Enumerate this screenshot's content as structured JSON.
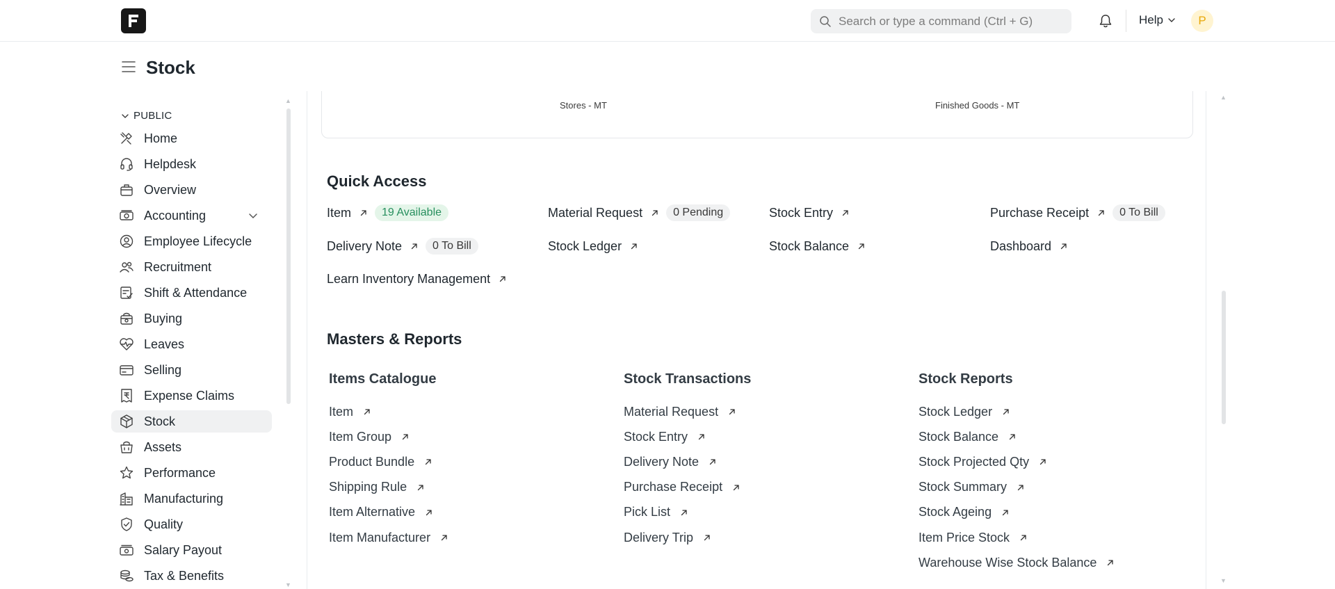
{
  "navbar": {
    "search_placeholder": "Search or type a command (Ctrl + G)",
    "help_label": "Help",
    "avatar_initial": "P"
  },
  "page": {
    "title": "Stock"
  },
  "sidebar": {
    "heading": "PUBLIC",
    "items": [
      {
        "label": "Home",
        "icon": "tools-icon"
      },
      {
        "label": "Helpdesk",
        "icon": "headset-icon"
      },
      {
        "label": "Overview",
        "icon": "briefcase-icon"
      },
      {
        "label": "Accounting",
        "icon": "money-icon"
      },
      {
        "label": "Employee Lifecycle",
        "icon": "user-circle-icon"
      },
      {
        "label": "Recruitment",
        "icon": "users-icon"
      },
      {
        "label": "Shift & Attendance",
        "icon": "checklist-icon"
      },
      {
        "label": "Buying",
        "icon": "bag-icon"
      },
      {
        "label": "Leaves",
        "icon": "heart-pulse-icon"
      },
      {
        "label": "Selling",
        "icon": "card-icon"
      },
      {
        "label": "Expense Claims",
        "icon": "rupee-receipt-icon"
      },
      {
        "label": "Stock",
        "icon": "box-icon",
        "active": true
      },
      {
        "label": "Assets",
        "icon": "basket-icon"
      },
      {
        "label": "Performance",
        "icon": "star-icon"
      },
      {
        "label": "Manufacturing",
        "icon": "building-icon"
      },
      {
        "label": "Quality",
        "icon": "shield-check-icon"
      },
      {
        "label": "Salary Payout",
        "icon": "cash-icon"
      },
      {
        "label": "Tax & Benefits",
        "icon": "coins-icon"
      }
    ]
  },
  "chart": {
    "label_left": "Stores - MT",
    "label_right": "Finished Goods - MT"
  },
  "quick_access": {
    "title": "Quick Access",
    "items": [
      {
        "label": "Item",
        "badge": "19 Available",
        "badge_color": "#278f5e"
      },
      {
        "label": "Material Request",
        "badge": "0 Pending"
      },
      {
        "label": "Stock Entry"
      },
      {
        "label": "Purchase Receipt",
        "badge": "0 To Bill"
      },
      {
        "label": "Delivery Note",
        "badge": "0 To Bill"
      },
      {
        "label": "Stock Ledger"
      },
      {
        "label": "Stock Balance"
      },
      {
        "label": "Dashboard"
      },
      {
        "label": "Learn Inventory Management"
      }
    ]
  },
  "masters": {
    "title": "Masters & Reports",
    "columns": [
      {
        "title": "Items Catalogue",
        "links": [
          "Item",
          "Item Group",
          "Product Bundle",
          "Shipping Rule",
          "Item Alternative",
          "Item Manufacturer"
        ]
      },
      {
        "title": "Stock Transactions",
        "links": [
          "Material Request",
          "Stock Entry",
          "Delivery Note",
          "Purchase Receipt",
          "Pick List",
          "Delivery Trip"
        ]
      },
      {
        "title": "Stock Reports",
        "links": [
          "Stock Ledger",
          "Stock Balance",
          "Stock Projected Qty",
          "Stock Summary",
          "Stock Ageing",
          "Item Price Stock",
          "Warehouse Wise Stock Balance"
        ]
      }
    ]
  }
}
